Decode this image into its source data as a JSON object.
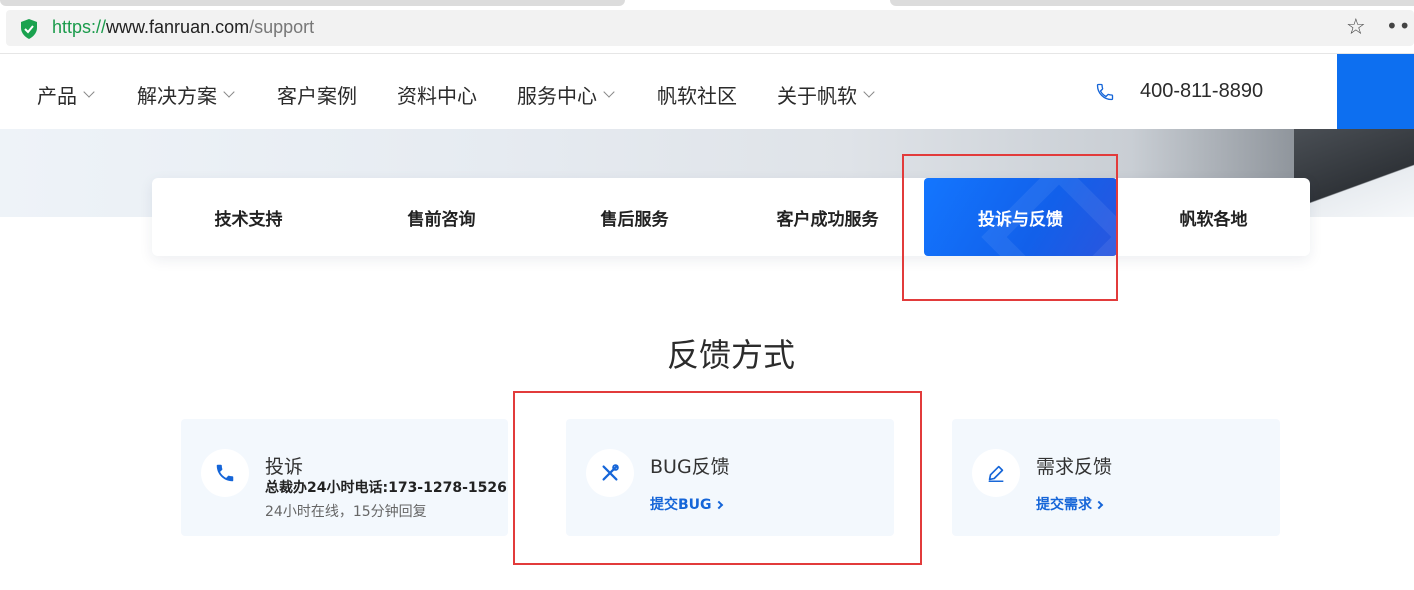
{
  "browser": {
    "url_scheme": "https://",
    "url_host": "www.fanruan.com",
    "url_path": "/support",
    "icons": [
      "shield-icon",
      "star-icon",
      "more-icon"
    ]
  },
  "nav": {
    "items": [
      {
        "label": "产品",
        "dropdown": true
      },
      {
        "label": "解决方案",
        "dropdown": true
      },
      {
        "label": "客户案例",
        "dropdown": false
      },
      {
        "label": "资料中心",
        "dropdown": false
      },
      {
        "label": "服务中心",
        "dropdown": true
      },
      {
        "label": "帆软社区",
        "dropdown": false
      },
      {
        "label": "关于帆软",
        "dropdown": true
      }
    ],
    "phone": "400-811-8890"
  },
  "tabs": {
    "items": [
      "技术支持",
      "售前咨询",
      "售后服务",
      "客户成功服务",
      "投诉与反馈",
      "帆软各地"
    ],
    "active": "投诉与反馈"
  },
  "section": {
    "title": "反馈方式"
  },
  "cards": {
    "complaint": {
      "title": "投诉",
      "hotline": "总裁办24小时电话:173-1278-1526",
      "note": "24小时在线，15分钟回复"
    },
    "bug": {
      "title": "BUG反馈",
      "link": "提交BUG"
    },
    "request": {
      "title": "需求反馈",
      "link": "提交需求"
    }
  },
  "colors": {
    "accent": "#0d6ff0",
    "highlight_box": "#e23b3b",
    "card_bg": "#f3f8fd",
    "link": "#1565d8"
  }
}
